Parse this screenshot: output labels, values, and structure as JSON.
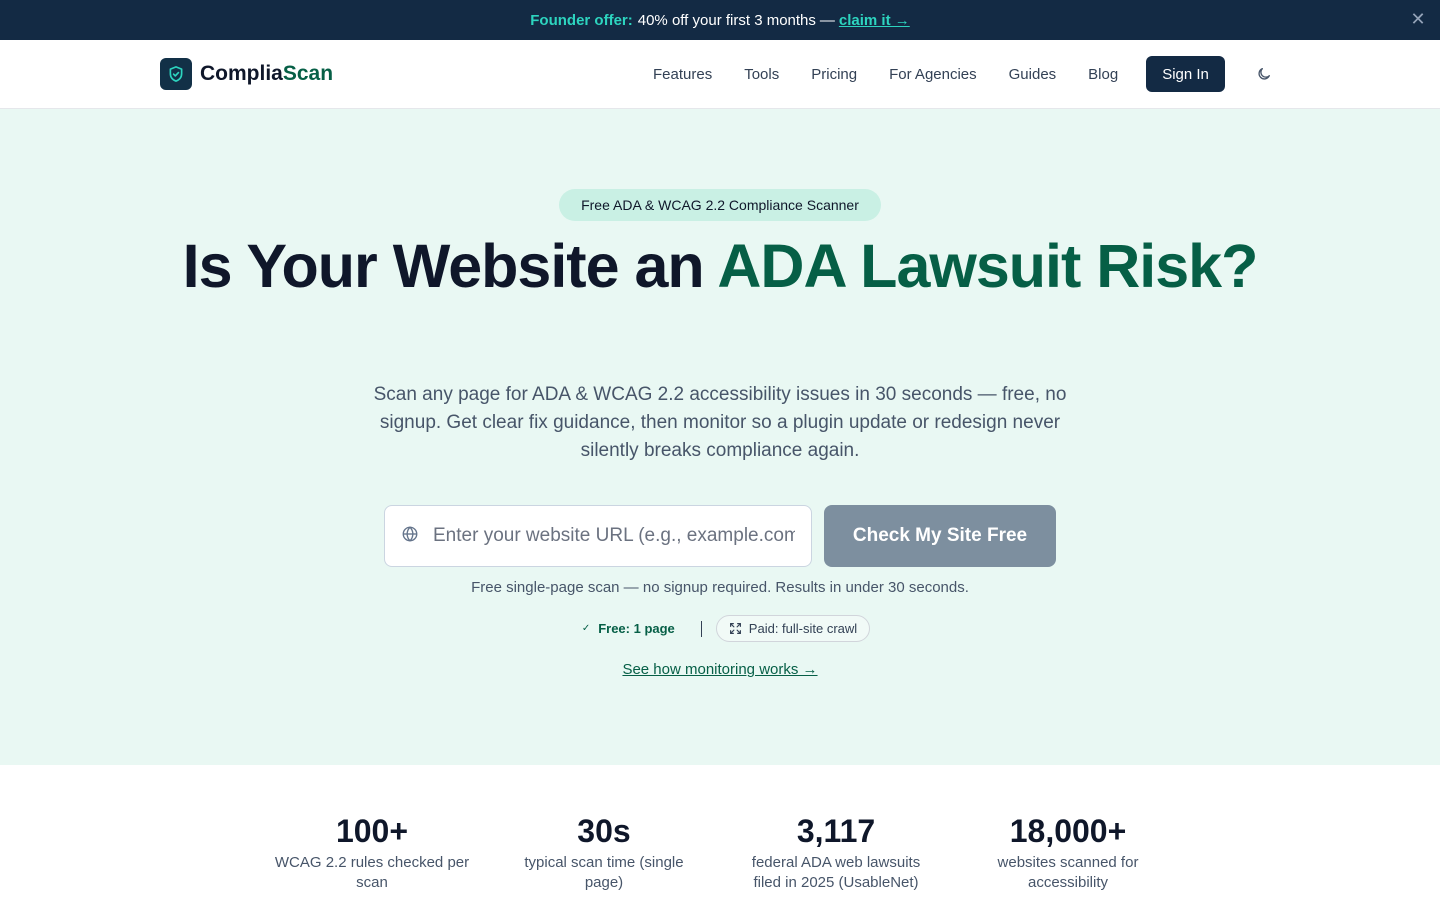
{
  "promo": {
    "highlight": "Founder offer:",
    "text": "40% off your first 3 months",
    "separator": "—",
    "link": "claim it →",
    "close_icon": "close-icon"
  },
  "header": {
    "logo": {
      "part1": "Complia",
      "part2": "Scan",
      "icon": "shield-check-icon"
    },
    "nav": [
      "Features",
      "Tools",
      "Pricing",
      "For Agencies",
      "Guides",
      "Blog"
    ],
    "signin": "Sign In",
    "theme_icon": "moon-icon"
  },
  "hero": {
    "pill": "Free ADA & WCAG 2.2 Compliance Scanner",
    "title_plain": "Is Your Website an ",
    "title_accent": "ADA Lawsuit Risk?",
    "subtitle": "Scan any page for ADA & WCAG 2.2 accessibility issues in 30 seconds — free, no signup. Get clear fix guidance, then monitor so a plugin update or redesign never silently breaks compliance again.",
    "url_placeholder": "Enter your website URL (e.g., example.com)",
    "url_value": "",
    "cta": "Check My Site Free",
    "note": "Free single-page scan — no signup required. Results in under 30 seconds.",
    "tag_free": "Free: 1 page",
    "tag_paid": "Paid: full-site crawl",
    "how_link": "See how monitoring works →"
  },
  "stats": [
    {
      "value": "100+",
      "label": "WCAG 2.2 rules checked per scan"
    },
    {
      "value": "30s",
      "label": "typical scan time (single page)"
    },
    {
      "value": "3,117",
      "label": "federal ADA web lawsuits filed in 2025 (UsableNet)"
    },
    {
      "value": "18,000+",
      "label": "websites scanned for accessibility"
    }
  ],
  "colors": {
    "navy": "#132a44",
    "accent_green": "#065f46",
    "teal": "#2dd4bf",
    "hero_bg": "#e9f8f3",
    "cta_disabled": "#7d8f9f"
  }
}
